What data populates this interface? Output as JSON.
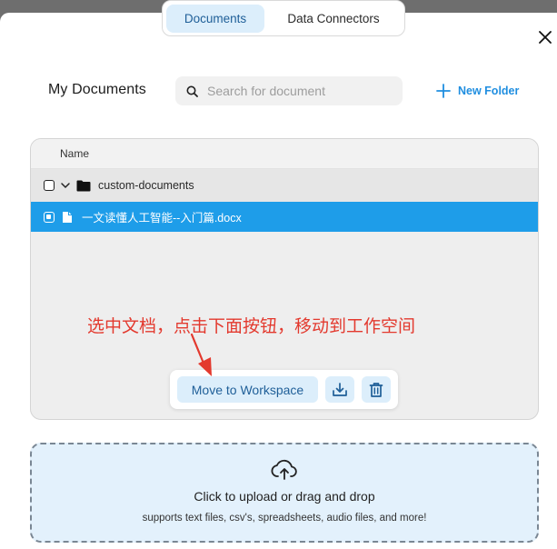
{
  "tabs": [
    {
      "label": "Documents",
      "active": true
    },
    {
      "label": "Data Connectors",
      "active": false
    }
  ],
  "header": {
    "title": "My Documents",
    "search_placeholder": "Search for document",
    "new_folder_label": "New Folder"
  },
  "documents": {
    "column_name": "Name",
    "folder_name": "custom-documents",
    "file_name": "一文读懂人工智能--入门篇.docx"
  },
  "annotation": {
    "text": "选中文档，点击下面按钮，移动到工作空间"
  },
  "actions": {
    "move_label": "Move to Workspace"
  },
  "upload": {
    "title": "Click to upload or drag and drop",
    "subtitle": "supports text files, csv's, spreadsheets, audio files, and more!"
  },
  "colors": {
    "accent": "#1e9de9",
    "annotation": "#e3392e",
    "tab_active_bg": "#dceefb"
  }
}
